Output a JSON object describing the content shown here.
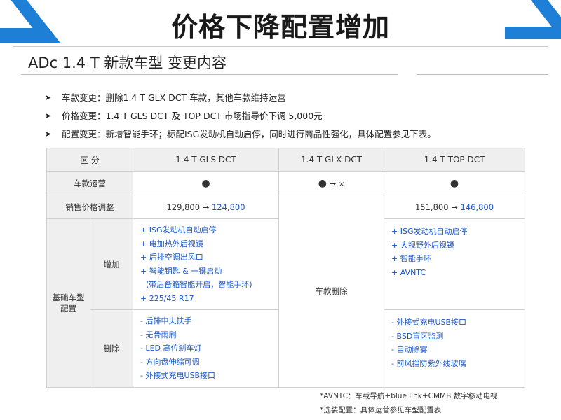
{
  "header": {
    "title": "价格下降配置增加"
  },
  "subtitle": "ADc  1.4 T 新款车型 变更内容",
  "bullets": [
    "车款变更：删除1.4 T GLX DCT 车款，其他车款维持运营",
    "价格变更：1.4 T GLS DCT 及 TOP DCT 市场指导价下调 5,000元",
    "配置变更：新增智能手环；标配ISG发动机自动启停，同时进行商品性强化，具体配置参见下表。"
  ],
  "table": {
    "header": {
      "section": "区  分",
      "gls": "1.4 T GLS DCT",
      "glx": "1.4 T GLX DCT",
      "top": "1.4 T TOP DCT"
    },
    "operation": {
      "label": "车款运营",
      "gls": "●",
      "glx_dot": "●",
      "glx_arrow": "→",
      "glx_x": "×",
      "top": "●"
    },
    "price": {
      "label": "销售价格调整",
      "gls_old": "129,800",
      "gls_arrow": "→",
      "gls_new": "124,800",
      "top_old": "151,800",
      "top_arrow": "→",
      "top_new": "146,800"
    },
    "basic_label_1": "基础车型",
    "basic_label_2": "配置",
    "add": {
      "label": "增加",
      "gls": [
        "+ ISG发动机自动启停",
        "+ 电加热外后视镜",
        "+ 后排空调出风口",
        "+ 智能钥匙 & 一键启动",
        "  (带后备箱智能开启，智能手环)",
        "+ 225/45 R17"
      ],
      "top": [
        "+ ISG发动机自动启停",
        "+ 大视野外后视镜",
        "+ 智能手环",
        "+ AVNTC"
      ]
    },
    "glx_deleted": "车款删除",
    "remove": {
      "label": "删除",
      "gls": [
        "- 后排中央扶手",
        "- 无骨雨刷",
        "- LED 高位刹车灯",
        "- 方向盘伸缩可调",
        "- 外接式充电USB接口"
      ],
      "top": [
        "- 外接式充电USB接口",
        "- BSD盲区监测",
        "- 自动除雾",
        "- 前风挡防紫外线玻璃"
      ]
    }
  },
  "footnotes": [
    "*AVNTC：车载导航+blue link+CMMB 数字移动电视",
    "*选装配置：具体运营参见车型配置表"
  ],
  "colors": {
    "accent_blue": "#1e7fd6",
    "text_blue": "#1a55c6",
    "header_gray": "#efefef"
  }
}
